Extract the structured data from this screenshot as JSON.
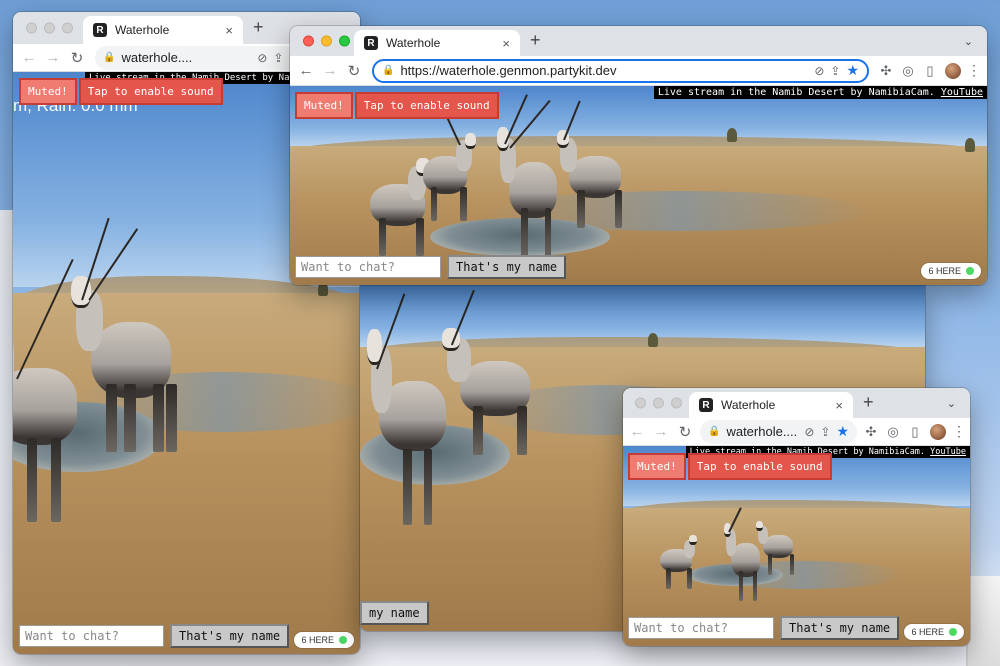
{
  "browser": {
    "tab_title": "Waterhole",
    "url_full": "https://waterhole.genmon.partykit.dev",
    "url_short": "waterhole....",
    "new_tab_glyph": "+",
    "close_glyph": "×"
  },
  "page": {
    "stream_credit_text": "Live stream in the Namib Desert by NamibiaCam.",
    "stream_credit_link": "YouTube",
    "muted_label": "Muted!",
    "sound_label": "Tap to enable sound",
    "chat_placeholder": "Want to chat?",
    "name_button": "That's my name",
    "here_count": "6 HERE",
    "weather_text": "m, Rain: 0.0 mm"
  },
  "icons": [
    "back-icon",
    "forward-icon",
    "reload-icon",
    "lock-icon",
    "eye-off-icon",
    "share-icon",
    "star-icon",
    "puzzle-icon",
    "sidebar-icon",
    "profile-avatar",
    "menu-icon"
  ],
  "colors": {
    "accent": "#1a73e8",
    "muted_btn": "#f07b70",
    "sound_btn": "#e4554c",
    "presence_dot": "#4cd964"
  }
}
